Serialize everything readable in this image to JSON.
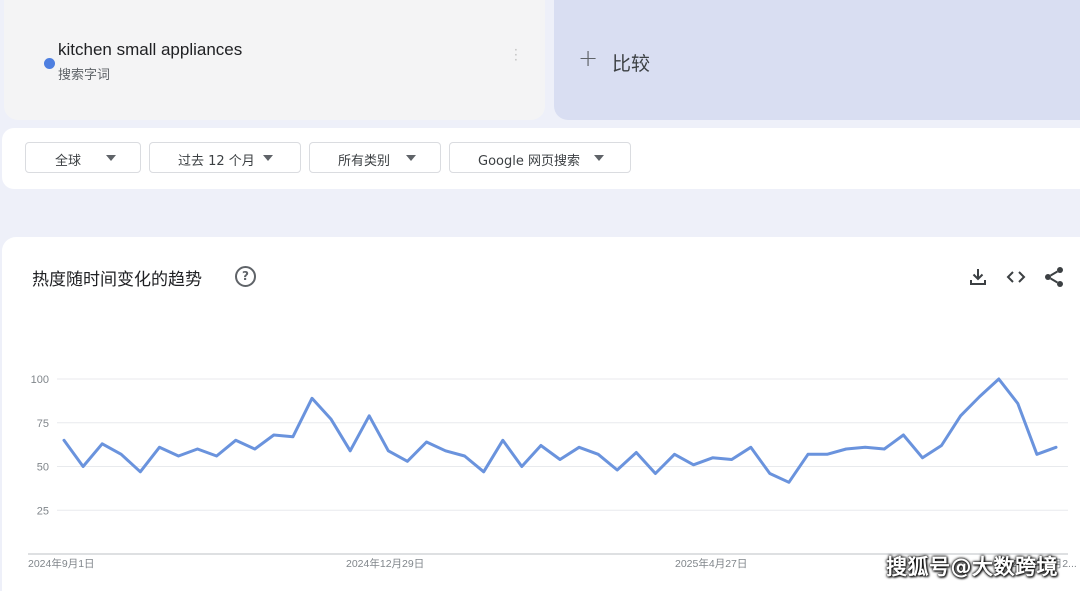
{
  "term": {
    "name": "kitchen small appliances",
    "subtitle": "搜索字词",
    "color": "#4e7fe0"
  },
  "compare": {
    "label": "比较",
    "icon": "plus-icon"
  },
  "filters": {
    "region": "全球",
    "time": "过去 12 个月",
    "category": "所有类别",
    "search_type": "Google 网页搜索"
  },
  "chart": {
    "title": "热度随时间变化的趋势",
    "help_icon": "help-icon",
    "tools": [
      "download-icon",
      "embed-icon",
      "share-icon"
    ]
  },
  "chart_data": {
    "type": "line",
    "ylim": [
      0,
      100
    ],
    "yticks": [
      25,
      50,
      75,
      100
    ],
    "xtick_labels": [
      "2024年9月1日",
      "2024年12月29日",
      "2025年4月27日",
      "2025年8月2..."
    ],
    "grid": true,
    "series": [
      {
        "color": "#6a93dd",
        "values": [
          65,
          50,
          63,
          57,
          47,
          61,
          56,
          60,
          56,
          65,
          60,
          68,
          67,
          89,
          77,
          59,
          79,
          59,
          53,
          64,
          59,
          56,
          47,
          65,
          50,
          62,
          54,
          61,
          57,
          48,
          58,
          46,
          57,
          51,
          55,
          54,
          61,
          46,
          41,
          57,
          57,
          60,
          61,
          60,
          68,
          55,
          62,
          79,
          90,
          100,
          86,
          57,
          61
        ]
      }
    ]
  },
  "watermark": "搜狐号@大数跨境"
}
